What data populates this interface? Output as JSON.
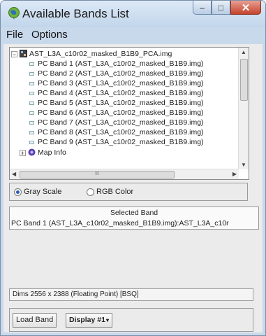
{
  "window": {
    "title": "Available Bands List",
    "controls": {
      "minimize": "–",
      "maximize": "□",
      "close": "✕"
    }
  },
  "menu": {
    "items": [
      "File",
      "Options"
    ]
  },
  "tree": {
    "root_label": "AST_L3A_c10r02_masked_B1B9_PCA.img",
    "bands": [
      "PC Band 1 (AST_L3A_c10r02_masked_B1B9.img)",
      "PC Band 2 (AST_L3A_c10r02_masked_B1B9.img)",
      "PC Band 3 (AST_L3A_c10r02_masked_B1B9.img)",
      "PC Band 4 (AST_L3A_c10r02_masked_B1B9.img)",
      "PC Band 5 (AST_L3A_c10r02_masked_B1B9.img)",
      "PC Band 6 (AST_L3A_c10r02_masked_B1B9.img)",
      "PC Band 7 (AST_L3A_c10r02_masked_B1B9.img)",
      "PC Band 8 (AST_L3A_c10r02_masked_B1B9.img)",
      "PC Band 9 (AST_L3A_c10r02_masked_B1B9.img)"
    ],
    "map_info_label": "Map Info",
    "hscroll_thumb_glyph": "III"
  },
  "mode": {
    "gray_scale_label": "Gray Scale",
    "rgb_color_label": "RGB Color",
    "selected": "gray_scale"
  },
  "selected_band": {
    "title": "Selected Band",
    "value": "PC Band 1 (AST_L3A_c10r02_masked_B1B9.img):AST_L3A_c10r"
  },
  "dims": {
    "text": "Dims 2556 x 2388 (Floating Point) [BSQ]"
  },
  "buttons": {
    "load_band": "Load Band",
    "display": "Display #1"
  },
  "colors": {
    "titlebar": "#c9d9ec",
    "close_button": "#c5432d",
    "radio_selected": "#2a5db0"
  }
}
